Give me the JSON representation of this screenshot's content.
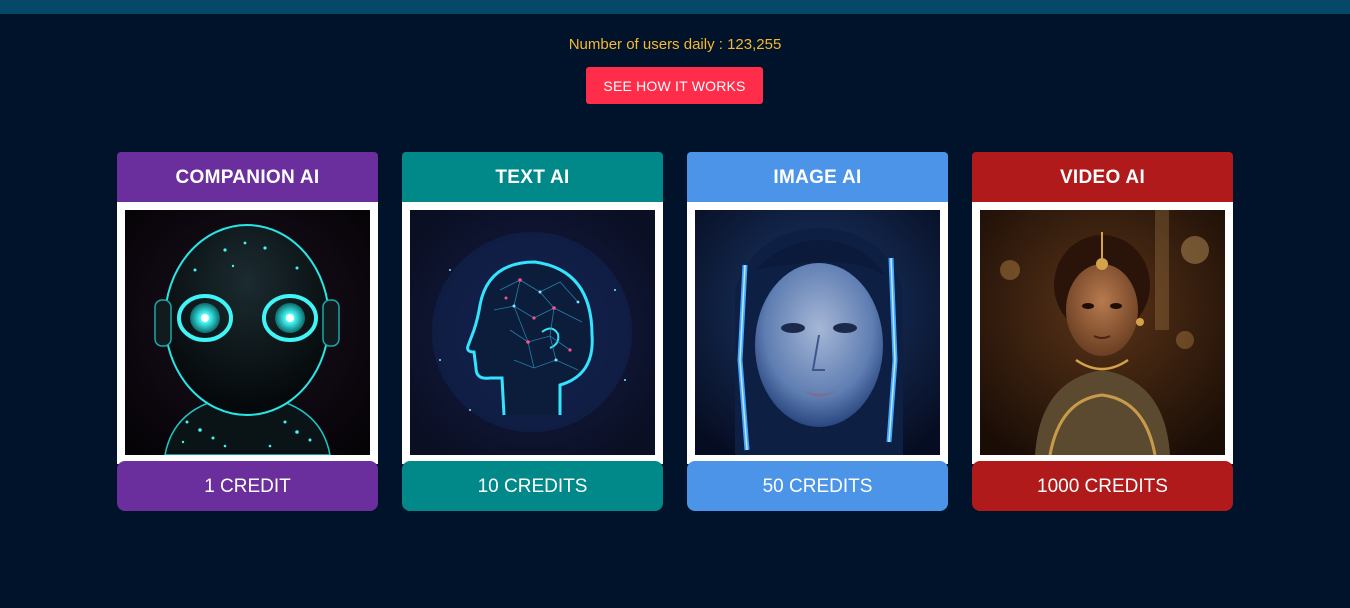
{
  "stats": {
    "users_daily": "Number of users daily : 123,255"
  },
  "cta": {
    "label": "SEE HOW IT WORKS"
  },
  "cards": [
    {
      "title": "COMPANION AI",
      "price": "1 CREDIT",
      "color": "#6a2f9c",
      "image": "glowing-robot-head"
    },
    {
      "title": "TEXT AI",
      "price": "10 CREDITS",
      "color": "#01898a",
      "image": "neural-head-profile"
    },
    {
      "title": "IMAGE AI",
      "price": "50 CREDITS",
      "color": "#4b94e8",
      "image": "neon-lit-woman-portrait"
    },
    {
      "title": "VIDEO AI",
      "price": "1000 CREDITS",
      "color": "#b01a1a",
      "image": "girl-in-traditional-dress"
    }
  ],
  "colors": {
    "background": "#00132a",
    "topbar": "#06486a",
    "stats_text": "#f5b82e",
    "cta": "#ff2d49"
  }
}
